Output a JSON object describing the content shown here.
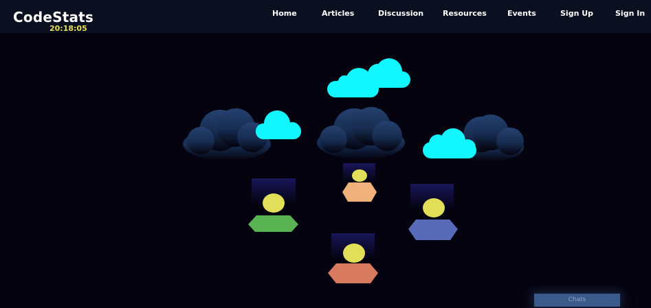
{
  "header": {
    "logo": "CodeStats",
    "clock": "20:18:05",
    "nav": [
      "Home",
      "Articles",
      "Discussion",
      "Resources",
      "Events",
      "Sign Up",
      "Sign In"
    ]
  },
  "chat": {
    "label": "Chats"
  },
  "colors": {
    "background": "#04030f",
    "header_bg": "#0b1020",
    "cloud_light": "#12f7ff",
    "cloud_dark_top": "#24416f",
    "avatar_head": "#e1de5a",
    "avatar_bodies": [
      "#5ab352",
      "#f0b27a",
      "#586ab8",
      "#d87a5e"
    ],
    "chat_button": "#3a5a8a"
  },
  "icons": [
    "storm-cloud-icon",
    "cloud-icon",
    "avatar-icon"
  ]
}
